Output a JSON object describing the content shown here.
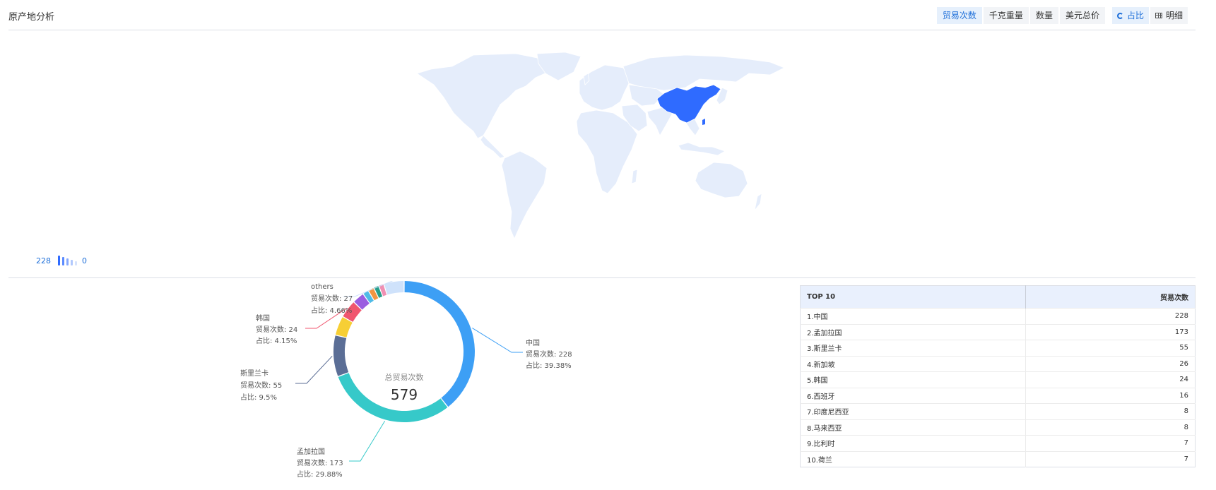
{
  "header": {
    "title": "原产地分析",
    "tabs": [
      {
        "label": "贸易次数",
        "active": true
      },
      {
        "label": "千克重量",
        "active": false
      },
      {
        "label": "数量",
        "active": false
      },
      {
        "label": "美元总价",
        "active": false
      }
    ],
    "views": [
      {
        "label": "占比",
        "icon": "donut-chart-icon",
        "active": true
      },
      {
        "label": "明细",
        "icon": "table-icon",
        "active": false
      }
    ]
  },
  "map": {
    "highlight_color": "#2f6bff",
    "base_color": "#e5edfb",
    "highlighted_country": "中国",
    "legend": {
      "max": "228",
      "min": "0"
    }
  },
  "colors": {
    "accent": "#1e6fd9"
  },
  "chart_data": {
    "type": "pie",
    "center_label": "总贸易次数",
    "center_value": "579",
    "slices": [
      {
        "name": "中国",
        "value": 228,
        "percent": "39.38%",
        "color": "#3d9ff5"
      },
      {
        "name": "孟加拉国",
        "value": 173,
        "percent": "29.88%",
        "color": "#36c9c9"
      },
      {
        "name": "斯里兰卡",
        "value": 55,
        "percent": "9.5%",
        "color": "#5b6e96"
      },
      {
        "name": "新加坡",
        "value": 26,
        "percent": "",
        "color": "#f7cf35"
      },
      {
        "name": "韩国",
        "value": 24,
        "percent": "4.15%",
        "color": "#f0566f"
      },
      {
        "name": "西班牙",
        "value": 16,
        "percent": "",
        "color": "#9b5de0"
      },
      {
        "name": "印度尼西亚",
        "value": 8,
        "percent": "",
        "color": "#4fbbe6"
      },
      {
        "name": "马来西亚",
        "value": 8,
        "percent": "",
        "color": "#f29542"
      },
      {
        "name": "比利时",
        "value": 7,
        "percent": "",
        "color": "#279e8a"
      },
      {
        "name": "荷兰",
        "value": 7,
        "percent": "",
        "color": "#ef8fb3"
      },
      {
        "name": "others",
        "value": 27,
        "percent": "4.66%",
        "color": "#cfe2fb"
      }
    ],
    "labeled": [
      {
        "name": "中国",
        "metric": "贸易次数: 228",
        "share": "占比: 39.38%"
      },
      {
        "name": "孟加拉国",
        "metric": "贸易次数: 173",
        "share": "占比: 29.88%"
      },
      {
        "name": "斯里兰卡",
        "metric": "贸易次数: 55",
        "share": "占比: 9.5%"
      },
      {
        "name": "韩国",
        "metric": "贸易次数: 24",
        "share": "占比: 4.15%"
      },
      {
        "name": "others",
        "metric": "贸易次数: 27",
        "share": "占比: 4.66%"
      }
    ]
  },
  "table": {
    "headers": [
      "TOP 10",
      "贸易次数"
    ],
    "rows": [
      {
        "name": "1.中国",
        "value": "228"
      },
      {
        "name": "2.孟加拉国",
        "value": "173"
      },
      {
        "name": "3.斯里兰卡",
        "value": "55"
      },
      {
        "name": "4.新加坡",
        "value": "26"
      },
      {
        "name": "5.韩国",
        "value": "24"
      },
      {
        "name": "6.西班牙",
        "value": "16"
      },
      {
        "name": "7.印度尼西亚",
        "value": "8"
      },
      {
        "name": "8.马来西亚",
        "value": "8"
      },
      {
        "name": "9.比利时",
        "value": "7"
      },
      {
        "name": "10.荷兰",
        "value": "7"
      }
    ]
  }
}
